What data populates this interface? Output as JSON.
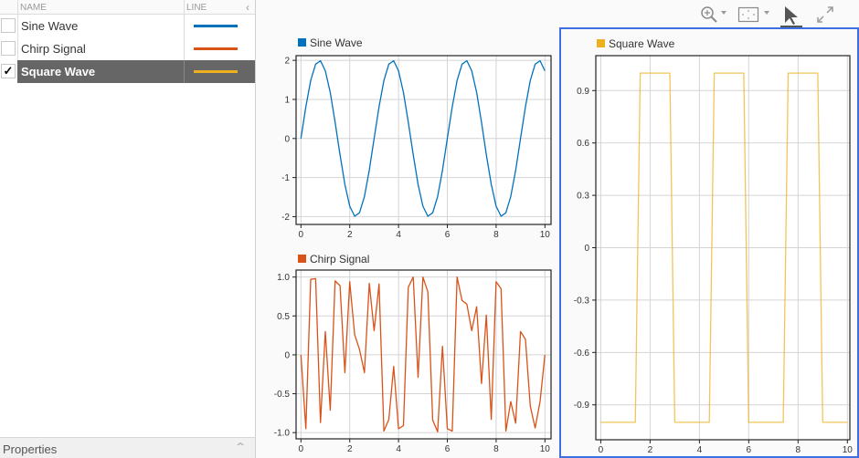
{
  "signal_table": {
    "columns": {
      "name": "NAME",
      "line": "LINE"
    },
    "collapse_icon": "chevron-left-icon",
    "rows": [
      {
        "name": "Sine Wave",
        "checked": false,
        "selected": false,
        "line_color": "#0072bd"
      },
      {
        "name": "Chirp Signal",
        "checked": false,
        "selected": false,
        "line_color": "#d95319"
      },
      {
        "name": "Square Wave",
        "checked": true,
        "selected": true,
        "line_color": "#edb120"
      }
    ],
    "check_glyph": "✓"
  },
  "properties_panel": {
    "label": "Properties",
    "expand_icon": "chevron-up-icon"
  },
  "toolbar": {
    "items": [
      {
        "name": "zoom-in",
        "icon": "zoom-in-icon",
        "has_dropdown": true
      },
      {
        "name": "fit-to-view",
        "icon": "fit-to-view-icon",
        "has_dropdown": true
      },
      {
        "name": "cursor",
        "icon": "cursor-icon",
        "active": true
      },
      {
        "name": "maximize",
        "icon": "maximize-icon"
      }
    ]
  },
  "colors": {
    "sine": "#0072bd",
    "chirp": "#d95319",
    "square": "#edb120",
    "active_border": "#3c6fe0",
    "selected_row_bg": "#666666"
  },
  "chart_data": [
    {
      "type": "line",
      "title": "Sine Wave",
      "legend": [
        "Sine Wave"
      ],
      "color": "#0072bd",
      "xlabel": "",
      "ylabel": "",
      "xlim": [
        -0.2,
        10.25
      ],
      "ylim": [
        -2.2,
        2.12
      ],
      "xticks": [
        0,
        2,
        4,
        6,
        8,
        10
      ],
      "yticks": [
        -2,
        -1,
        0,
        1,
        2
      ],
      "ytick_labels": [
        "-2",
        "-1",
        "0",
        "1",
        "2"
      ],
      "grid": true,
      "x": [
        0,
        0.2,
        0.4,
        0.6,
        0.8,
        1.0,
        1.2,
        1.4,
        1.6,
        1.8,
        2.0,
        2.2,
        2.4,
        2.6,
        2.8,
        3.0,
        3.2,
        3.4,
        3.6,
        3.8,
        4.0,
        4.2,
        4.4,
        4.6,
        4.8,
        5.0,
        5.2,
        5.4,
        5.6,
        5.8,
        6.0,
        6.2,
        6.4,
        6.6,
        6.8,
        7.0,
        7.2,
        7.4,
        7.6,
        7.8,
        8.0,
        8.2,
        8.4,
        8.6,
        8.8,
        9.0,
        9.2,
        9.4,
        9.6,
        9.8,
        10.0
      ],
      "y": [
        0,
        0.813,
        1.486,
        1.902,
        1.989,
        1.732,
        1.176,
        0.416,
        -0.416,
        -1.176,
        -1.732,
        -1.989,
        -1.902,
        -1.486,
        -0.813,
        0,
        0.813,
        1.486,
        1.902,
        1.989,
        1.732,
        1.176,
        0.416,
        -0.416,
        -1.176,
        -1.732,
        -1.989,
        -1.902,
        -1.486,
        -0.813,
        0,
        0.813,
        1.486,
        1.902,
        1.989,
        1.732,
        1.176,
        0.416,
        -0.416,
        -1.176,
        -1.732,
        -1.989,
        -1.902,
        -1.486,
        -0.813,
        0,
        0.813,
        1.486,
        1.902,
        1.989,
        1.732
      ]
    },
    {
      "type": "line",
      "title": "Chirp Signal",
      "legend": [
        "Chirp Signal"
      ],
      "color": "#d95319",
      "xlabel": "",
      "ylabel": "",
      "xlim": [
        -0.2,
        10.25
      ],
      "ylim": [
        -1.08,
        1.09
      ],
      "xticks": [
        0,
        2,
        4,
        6,
        8,
        10
      ],
      "yticks": [
        -1,
        -0.5,
        0,
        0.5,
        1
      ],
      "ytick_labels": [
        "-1.0",
        "-0.5",
        "0",
        "0.5",
        "1.0"
      ],
      "grid": true,
      "x": [
        0,
        0.2,
        0.4,
        0.6,
        0.8,
        1.0,
        1.2,
        1.4,
        1.6,
        1.8,
        2.0,
        2.2,
        2.4,
        2.6,
        2.8,
        3.0,
        3.2,
        3.4,
        3.6,
        3.8,
        4.0,
        4.2,
        4.4,
        4.6,
        4.8,
        5.0,
        5.2,
        5.4,
        5.6,
        5.8,
        6.0,
        6.2,
        6.4,
        6.6,
        6.8,
        7.0,
        7.2,
        7.4,
        7.6,
        7.8,
        8.0,
        8.2,
        8.4,
        8.6,
        8.8,
        9.0,
        9.2,
        9.4,
        9.6,
        9.8,
        10.0
      ],
      "y": [
        0,
        -0.95,
        0.97,
        0.98,
        -0.87,
        0.3,
        -0.71,
        0.95,
        0.89,
        -0.23,
        0.94,
        0.26,
        0.07,
        -0.23,
        0.92,
        0.31,
        0.91,
        -0.98,
        -0.83,
        -0.15,
        -0.95,
        -0.91,
        0.87,
        1.0,
        -0.29,
        1.0,
        0.81,
        -0.84,
        -0.99,
        0.11,
        -0.95,
        -0.98,
        1.0,
        0.7,
        0.65,
        0.31,
        0.62,
        -0.37,
        0.51,
        -0.83,
        0.94,
        0.85,
        -0.98,
        -0.6,
        -0.88,
        0.3,
        0.2,
        -0.66,
        -0.94,
        -0.6,
        0
      ]
    },
    {
      "type": "line",
      "title": "Square Wave",
      "legend": [
        "Square Wave"
      ],
      "color": "#edb120",
      "xlabel": "",
      "ylabel": "",
      "xlim": [
        -0.2,
        10.1
      ],
      "ylim": [
        -1.1,
        1.1
      ],
      "xticks": [
        0,
        2,
        4,
        6,
        8,
        10
      ],
      "yticks": [
        -0.9,
        -0.6,
        -0.3,
        0,
        0.3,
        0.6,
        0.9
      ],
      "ytick_labels": [
        "-0.9",
        "-0.6",
        "-0.3",
        "0",
        "0.3",
        "0.6",
        "0.9"
      ],
      "grid": true,
      "x": [
        0,
        0.2,
        0.4,
        0.6,
        0.8,
        1.0,
        1.2,
        1.4,
        1.6,
        1.8,
        2.0,
        2.2,
        2.4,
        2.6,
        2.8,
        3.0,
        3.2,
        3.4,
        3.6,
        3.8,
        4.0,
        4.2,
        4.4,
        4.6,
        4.8,
        5.0,
        5.2,
        5.4,
        5.6,
        5.8,
        6.0,
        6.2,
        6.4,
        6.6,
        6.8,
        7.0,
        7.2,
        7.4,
        7.6,
        7.8,
        8.0,
        8.2,
        8.4,
        8.6,
        8.8,
        9.0,
        9.2,
        9.4,
        9.6,
        9.8,
        10.0
      ],
      "y": [
        -1,
        -1,
        -1,
        -1,
        -1,
        -1,
        -1,
        -1,
        1,
        1,
        1,
        1,
        1,
        1,
        1,
        -1,
        -1,
        -1,
        -1,
        -1,
        -1,
        -1,
        -1,
        1,
        1,
        1,
        1,
        1,
        1,
        1,
        -1,
        -1,
        -1,
        -1,
        -1,
        -1,
        -1,
        -1,
        1,
        1,
        1,
        1,
        1,
        1,
        1,
        -1,
        -1,
        -1,
        -1,
        -1,
        -1
      ]
    }
  ]
}
